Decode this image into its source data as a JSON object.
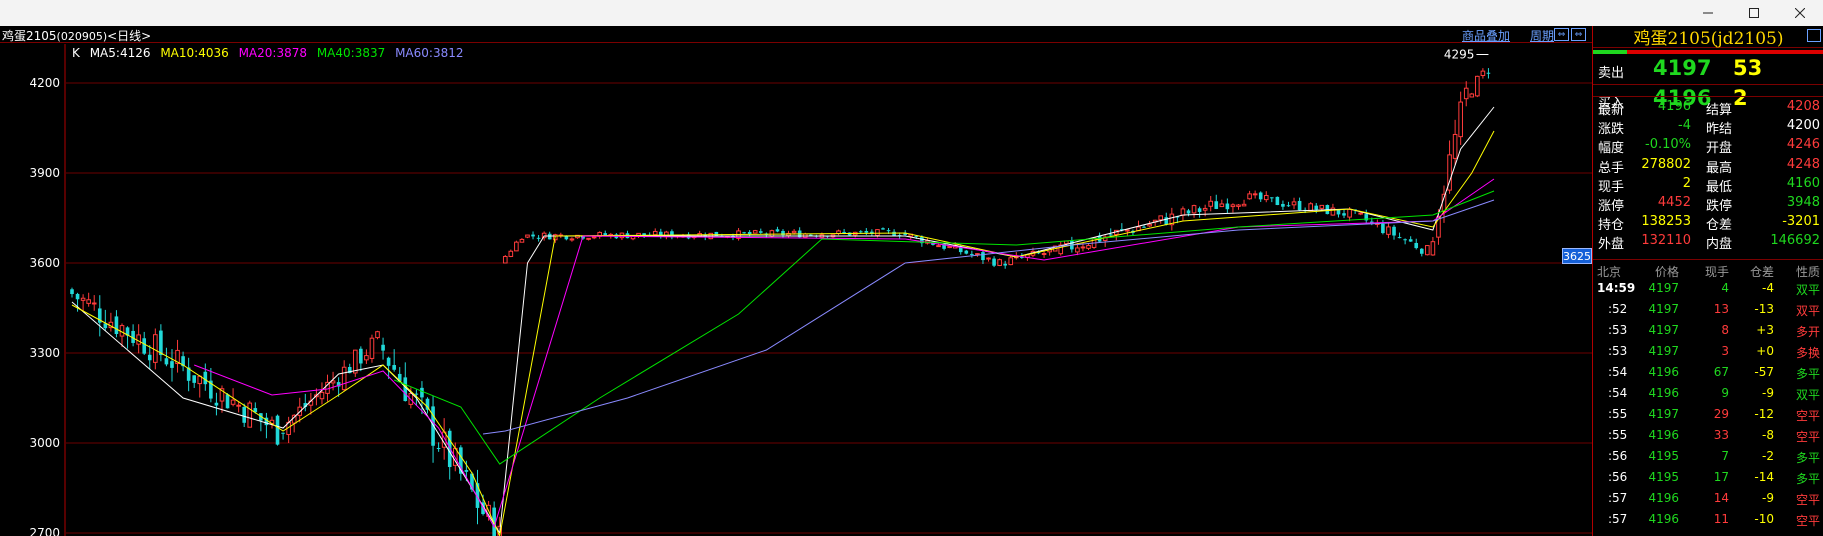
{
  "window": {
    "buttons": {
      "minimize": "minimize-icon",
      "maximize": "maximize-icon",
      "close": "close-icon"
    }
  },
  "chart": {
    "title": "鸡蛋2105",
    "code": "(020905)",
    "period": "<日线>",
    "header_links": {
      "overlay": "商品叠加",
      "cycle": "周期"
    },
    "ma_legend": {
      "k": "K",
      "ma5": "MA5:4126",
      "ma10": "MA10:4036",
      "ma20": "MA20:3878",
      "ma40": "MA40:3837",
      "ma60": "MA60:3812"
    },
    "ma_colors": {
      "ma5": "#ffffff",
      "ma10": "#ffff00",
      "ma20": "#ff00ff",
      "ma40": "#00e400",
      "ma60": "#8a8aff"
    },
    "high_annotation": "4295",
    "price_tag": "3625"
  },
  "chart_data": {
    "type": "candlestick",
    "y_ticks": [
      "4200",
      "3900",
      "3600",
      "3300",
      "3000",
      "2700"
    ],
    "ylim": [
      2690,
      4330
    ],
    "grid": true,
    "up_color": "#ff3b3b",
    "down_color": "#21d8d8",
    "candles_segments": [
      {
        "from": 0,
        "to": 38,
        "start": 3510,
        "end": 3040,
        "min": 2960,
        "max": 3520
      },
      {
        "from": 38,
        "to": 56,
        "start": 3040,
        "end": 3340,
        "min": 3000,
        "max": 3410
      },
      {
        "from": 56,
        "to": 78,
        "start": 3340,
        "end": 2680,
        "min": 2660,
        "max": 3360
      },
      {
        "from": 78,
        "to": 82,
        "start": 3600,
        "end": 3690,
        "min": 3600,
        "max": 3720
      },
      {
        "from": 82,
        "to": 150,
        "start": 3690,
        "end": 3700,
        "min": 3650,
        "max": 3780
      },
      {
        "from": 150,
        "to": 168,
        "start": 3700,
        "end": 3600,
        "min": 3560,
        "max": 3720
      },
      {
        "from": 168,
        "to": 178,
        "start": 3600,
        "end": 3640,
        "min": 3520,
        "max": 3700
      },
      {
        "from": 178,
        "to": 212,
        "start": 3640,
        "end": 3820,
        "min": 3620,
        "max": 3880
      },
      {
        "from": 212,
        "to": 232,
        "start": 3820,
        "end": 3760,
        "min": 3680,
        "max": 3860
      },
      {
        "from": 232,
        "to": 245,
        "start": 3760,
        "end": 3640,
        "min": 3620,
        "max": 3820
      },
      {
        "from": 245,
        "to": 252,
        "start": 3640,
        "end": 4160,
        "min": 3620,
        "max": 4210
      },
      {
        "from": 252,
        "to": 256,
        "start": 4160,
        "end": 4250,
        "min": 4060,
        "max": 4295
      }
    ],
    "ma_lines": {
      "ma5": [
        [
          0,
          3470
        ],
        [
          20,
          3150
        ],
        [
          38,
          3050
        ],
        [
          48,
          3230
        ],
        [
          56,
          3260
        ],
        [
          62,
          3150
        ],
        [
          72,
          2850
        ],
        [
          77,
          2700
        ],
        [
          82,
          3600
        ],
        [
          85,
          3690
        ],
        [
          150,
          3690
        ],
        [
          170,
          3620
        ],
        [
          200,
          3760
        ],
        [
          230,
          3780
        ],
        [
          245,
          3710
        ],
        [
          250,
          3980
        ],
        [
          256,
          4120
        ]
      ],
      "ma10": [
        [
          0,
          3460
        ],
        [
          20,
          3260
        ],
        [
          38,
          3040
        ],
        [
          48,
          3160
        ],
        [
          56,
          3260
        ],
        [
          64,
          3120
        ],
        [
          72,
          2900
        ],
        [
          77,
          2690
        ],
        [
          87,
          3690
        ],
        [
          150,
          3700
        ],
        [
          170,
          3620
        ],
        [
          200,
          3740
        ],
        [
          230,
          3780
        ],
        [
          245,
          3720
        ],
        [
          252,
          3900
        ],
        [
          256,
          4040
        ]
      ],
      "ma20": [
        [
          22,
          3260
        ],
        [
          36,
          3160
        ],
        [
          46,
          3180
        ],
        [
          56,
          3240
        ],
        [
          66,
          3050
        ],
        [
          76,
          2720
        ],
        [
          92,
          3690
        ],
        [
          150,
          3680
        ],
        [
          175,
          3610
        ],
        [
          210,
          3720
        ],
        [
          245,
          3740
        ],
        [
          256,
          3880
        ]
      ],
      "ma40": [
        [
          58,
          3210
        ],
        [
          70,
          3120
        ],
        [
          77,
          2930
        ],
        [
          95,
          3150
        ],
        [
          120,
          3430
        ],
        [
          135,
          3680
        ],
        [
          170,
          3660
        ],
        [
          210,
          3720
        ],
        [
          245,
          3760
        ],
        [
          256,
          3840
        ]
      ],
      "ma60": [
        [
          74,
          3030
        ],
        [
          78,
          3040
        ],
        [
          100,
          3150
        ],
        [
          125,
          3310
        ],
        [
          150,
          3600
        ],
        [
          180,
          3660
        ],
        [
          210,
          3710
        ],
        [
          245,
          3740
        ],
        [
          256,
          3810
        ]
      ]
    }
  },
  "panel": {
    "title": "鸡蛋2105(jd2105)",
    "ask": {
      "label": "卖出",
      "price": "4197",
      "volume": "53"
    },
    "bid": {
      "label": "买入",
      "price": "4196",
      "volume": "2"
    },
    "stats": [
      {
        "l1": "最新",
        "v1": "4196",
        "c1": "green",
        "l2": "结算",
        "v2": "4208",
        "c2": "red"
      },
      {
        "l1": "涨跌",
        "v1": "-4",
        "c1": "green",
        "l2": "昨结",
        "v2": "4200",
        "c2": "white"
      },
      {
        "l1": "幅度",
        "v1": "-0.10%",
        "c1": "green",
        "l2": "开盘",
        "v2": "4246",
        "c2": "red"
      },
      {
        "l1": "总手",
        "v1": "278802",
        "c1": "yellow",
        "l2": "最高",
        "v2": "4248",
        "c2": "red"
      },
      {
        "l1": "现手",
        "v1": "2",
        "c1": "yellow",
        "l2": "最低",
        "v2": "4160",
        "c2": "green"
      },
      {
        "l1": "涨停",
        "v1": "4452",
        "c1": "red",
        "l2": "跌停",
        "v2": "3948",
        "c2": "green"
      },
      {
        "l1": "持仓",
        "v1": "138253",
        "c1": "yellow",
        "l2": "仓差",
        "v2": "-3201",
        "c2": "yellow"
      },
      {
        "l1": "外盘",
        "v1": "132110",
        "c1": "red",
        "l2": "内盘",
        "v2": "146692",
        "c2": "green"
      }
    ],
    "ticks_header": {
      "time": "北京",
      "price": "价格",
      "qty": "现手",
      "diff": "仓差",
      "nature": "性质"
    },
    "ticks": [
      {
        "t": "14:59",
        "p": "4197",
        "pc": "green",
        "q": "4",
        "qc": "green",
        "d": "-4",
        "n": "双平",
        "nc": "green"
      },
      {
        "t": ":52",
        "p": "4197",
        "pc": "green",
        "q": "13",
        "qc": "red",
        "d": "-13",
        "n": "双平",
        "nc": "red"
      },
      {
        "t": ":53",
        "p": "4197",
        "pc": "green",
        "q": "8",
        "qc": "red",
        "d": "+3",
        "n": "多开",
        "nc": "red"
      },
      {
        "t": ":53",
        "p": "4197",
        "pc": "green",
        "q": "3",
        "qc": "red",
        "d": "+0",
        "n": "多换",
        "nc": "red"
      },
      {
        "t": ":54",
        "p": "4196",
        "pc": "green",
        "q": "67",
        "qc": "green",
        "d": "-57",
        "n": "多平",
        "nc": "green"
      },
      {
        "t": ":54",
        "p": "4196",
        "pc": "green",
        "q": "9",
        "qc": "green",
        "d": "-9",
        "n": "双平",
        "nc": "green"
      },
      {
        "t": ":55",
        "p": "4197",
        "pc": "green",
        "q": "29",
        "qc": "red",
        "d": "-12",
        "n": "空平",
        "nc": "red"
      },
      {
        "t": ":55",
        "p": "4196",
        "pc": "green",
        "q": "33",
        "qc": "red",
        "d": "-8",
        "n": "空平",
        "nc": "red"
      },
      {
        "t": ":56",
        "p": "4195",
        "pc": "green",
        "q": "7",
        "qc": "green",
        "d": "-2",
        "n": "多平",
        "nc": "green"
      },
      {
        "t": ":56",
        "p": "4195",
        "pc": "green",
        "q": "17",
        "qc": "green",
        "d": "-14",
        "n": "多平",
        "nc": "green"
      },
      {
        "t": ":57",
        "p": "4196",
        "pc": "green",
        "q": "14",
        "qc": "red",
        "d": "-9",
        "n": "空平",
        "nc": "red"
      },
      {
        "t": ":57",
        "p": "4196",
        "pc": "green",
        "q": "11",
        "qc": "red",
        "d": "-10",
        "n": "空平",
        "nc": "red"
      }
    ]
  }
}
